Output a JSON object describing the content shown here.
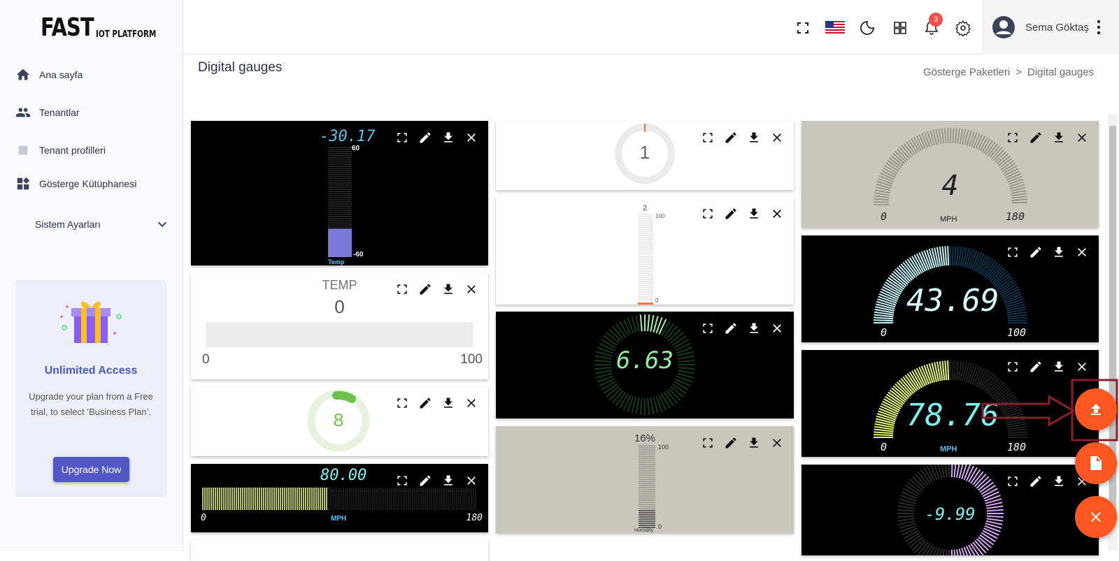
{
  "app": {
    "logo_main": "FAST",
    "logo_sub": "IOT PLATFORM"
  },
  "sidebar": {
    "items": [
      {
        "label": "Ana sayfa",
        "icon": "home-icon"
      },
      {
        "label": "Tenantlar",
        "icon": "people-icon"
      },
      {
        "label": "Tenant profilleri",
        "icon": "profile-icon"
      },
      {
        "label": "Gösterge Kütüphanesi",
        "icon": "dashboard-icon"
      }
    ],
    "settings_label": "Sistem Ayarları",
    "promo": {
      "title": "Unlimited Access",
      "text": "Upgrade your plan from a Free trial, to select ‘Business Plan’.",
      "button": "Upgrade Now"
    }
  },
  "header": {
    "notification_count": "3",
    "user_name": "Sema Göktaş",
    "icons": [
      "fullscreen-icon",
      "us-flag-icon",
      "moon-icon",
      "apps-icon",
      "bell-icon",
      "gear-icon",
      "avatar-icon",
      "more-vert-icon"
    ]
  },
  "page": {
    "title": "Digital gauges",
    "breadcrumb": [
      "Gösterge Paketleri",
      ">",
      "Digital gauges"
    ]
  },
  "widgets": {
    "thermometer": {
      "value": "-30.17",
      "max": "60",
      "min": "-60",
      "label": "Temp"
    },
    "temp_bar": {
      "title": "TEMP",
      "value": "0",
      "min": "0",
      "max": "100"
    },
    "donut_green": {
      "value": "8"
    },
    "speed_bar": {
      "value": "80.00",
      "min": "0",
      "max": "180",
      "unit": "MPH"
    },
    "donut_gray": {
      "value": "1"
    },
    "white_vertical": {
      "value": "2",
      "max": "100",
      "min": "0"
    },
    "radial_green": {
      "value": "6.63"
    },
    "humidity": {
      "value": "16%",
      "max": "100",
      "min": "0",
      "label": "Humidity"
    },
    "speedo_gray": {
      "value": "4",
      "min": "0",
      "max": "180",
      "unit": "MPH"
    },
    "arc_blue": {
      "value": "43.69",
      "min": "0",
      "max": "100"
    },
    "arc_yellow": {
      "value": "78.76",
      "min": "0",
      "max": "180",
      "unit": "MPH"
    },
    "radial_purple": {
      "value": "-9.99"
    }
  },
  "colors": {
    "accent": "#ff5722",
    "promo_button": "#5157c5",
    "highlight_box": "#8b1d2c"
  }
}
